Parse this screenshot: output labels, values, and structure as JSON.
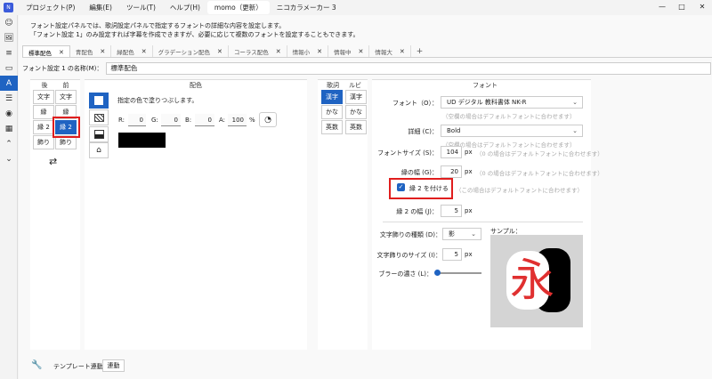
{
  "titlebar": {
    "menus": [
      "プロジェクト(P)",
      "編集(E)",
      "ツール(T)",
      "ヘルプ(H)"
    ],
    "doc_tab": "momo（更新）",
    "app_name": "ニコカラメーカー 3",
    "min": "—",
    "max": "□",
    "close": "✕"
  },
  "info": {
    "line1": "フォント設定パネルでは、歌詞設定パネルで指定するフォントの詳細な内容を設定します。",
    "line2": "「フォント設定 1」のみ設定すれば字幕を作成できますが、必要に応じて複数のフォントを設定することもできます。"
  },
  "tabs": [
    {
      "label": "標準配色",
      "active": true
    },
    {
      "label": "青配色"
    },
    {
      "label": "緑配色"
    },
    {
      "label": "グラデーション配色"
    },
    {
      "label": "コーラス配色"
    },
    {
      "label": "情報小"
    },
    {
      "label": "情報中"
    },
    {
      "label": "情報大"
    }
  ],
  "tab_close": "✕",
  "tab_add": "+",
  "name_row": {
    "label": "フォント設定 1 の名称(M)：",
    "value": "標準配色"
  },
  "target": {
    "header_after": "後",
    "header_before": "前",
    "after": [
      "文字",
      "縁",
      "縁 2",
      "飾り"
    ],
    "before": [
      "文字",
      "縁",
      "縁 2",
      "飾り"
    ],
    "swap": "⇄"
  },
  "color": {
    "header": "配色",
    "description": "指定の色で塗りつぶします。",
    "r_label": "R:",
    "r": "0",
    "g_label": "G:",
    "g": "0",
    "b_label": "B:",
    "b": "0",
    "a_label": "A:",
    "a": "100",
    "pct": "%",
    "swatch": "#000000",
    "palette_icon": "palette-icon"
  },
  "font": {
    "col_lyrics": "歌詞",
    "col_ruby": "ルビ",
    "lyrics_kinds": [
      "漢字",
      "かな",
      "英数"
    ],
    "ruby_kinds": [
      "漢字",
      "かな",
      "英数"
    ],
    "header": "フォント",
    "font_label": "フォント（O）：",
    "font_value": "UD デジタル 教科書体 NK-R",
    "font_hint": "（空欄の場合はデフォルトフォントに合わせます）",
    "detail_label": "詳細 (C)：",
    "detail_value": "Bold",
    "detail_hint": "（空欄の場合はデフォルトフォントに合わせます）",
    "size_label": "フォントサイズ (S)：",
    "size_value": "104",
    "size_unit": "px",
    "size_hint": "（0 の場合はデフォルトフォントに合わせます）",
    "edge_label": "縁の幅 (G)：",
    "edge_value": "20",
    "edge_unit": "px",
    "edge_hint": "（0 の場合はデフォルトフォントに合わせます）",
    "edge2_check_label": "縁 2 を付ける",
    "edge2_check_hint": "（この場合はデフォルトフォントに合わせます）",
    "edge2_label": "縁 2 の幅 (J)：",
    "edge2_value": "5",
    "edge2_unit": "px",
    "deco_type_label": "文字飾りの種類 (D)：",
    "deco_type_value": "影",
    "deco_size_label": "文字飾りのサイズ (I)：",
    "deco_size_value": "5",
    "deco_size_unit": "px",
    "blur_label": "ブラーの濃さ (L)：",
    "blur_level": 0,
    "sample_label": "サンプル：",
    "sample_char": "永"
  },
  "bottom": {
    "label": "テンプレート連動：",
    "button": "連動"
  },
  "colors": {
    "accent": "#1f63c2",
    "highlight": "#e01e1e",
    "sample_bg": "#d4d4d4",
    "sample_char": "#e03030"
  }
}
